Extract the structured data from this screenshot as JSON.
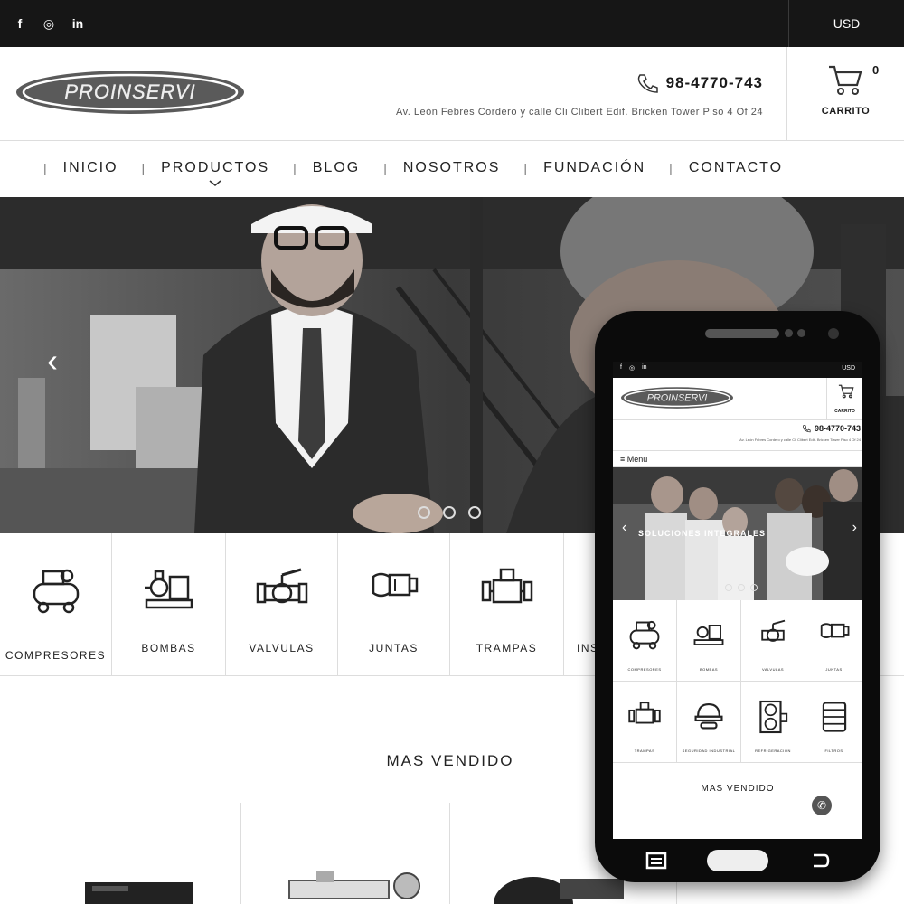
{
  "topbar": {
    "social": [
      {
        "icon": "facebook-icon",
        "glyph": "f"
      },
      {
        "icon": "instagram-icon",
        "glyph": "◎"
      },
      {
        "icon": "linkedin-icon",
        "glyph": "in"
      }
    ],
    "currency": "USD"
  },
  "header": {
    "logo_text": "PROINSERVI",
    "phone": "98-4770-743",
    "address": "Av. León Febres Cordero y calle Cli Clibert Edif. Bricken Tower Piso 4 Of 24",
    "cart_count": "0",
    "cart_label": "CARRITO"
  },
  "nav": {
    "items": [
      {
        "label": "INICIO"
      },
      {
        "label": "PRODUCTOS"
      },
      {
        "label": "BLOG"
      },
      {
        "label": "NOSOTROS"
      },
      {
        "label": "FUNDACIÓN"
      },
      {
        "label": "CONTACTO"
      }
    ]
  },
  "hero": {
    "prev_arrow": "‹",
    "slide_count": 3
  },
  "categories": [
    {
      "label": "COMPRESORES",
      "icon": "compressor-icon"
    },
    {
      "label": "BOMBAS",
      "icon": "pump-icon"
    },
    {
      "label": "VALVULAS",
      "icon": "valve-icon"
    },
    {
      "label": "JUNTAS",
      "icon": "joint-icon"
    },
    {
      "label": "TRAMPAS",
      "icon": "trap-icon"
    },
    {
      "label": "INS",
      "icon": "instrument-icon"
    }
  ],
  "section_title": "MAS VENDIDO",
  "mobile": {
    "currency": "USD",
    "logo_text": "PROINSERVI",
    "cart_label": "CARRITO",
    "phone": "98-4770-743",
    "address": "Av. León Febres Cordero y calle Cli Clibert Edif. Bricken Tower Piso 4 Of 24",
    "menu_label": "≡ Menu",
    "hero_text": "SOLUCIONES INTEGRALES",
    "categories": [
      {
        "label": "COMPRESORES"
      },
      {
        "label": "BOMBAS"
      },
      {
        "label": "VALVULAS"
      },
      {
        "label": "JUNTAS"
      },
      {
        "label": "TRAMPAS"
      },
      {
        "label": "SEGURIDAD INDUSTRIAL"
      },
      {
        "label": "REFRIGERACIÓN"
      },
      {
        "label": "FILTROS"
      }
    ],
    "section_title": "MAS VENDIDO",
    "whatsapp_icon": "whatsapp-icon"
  }
}
